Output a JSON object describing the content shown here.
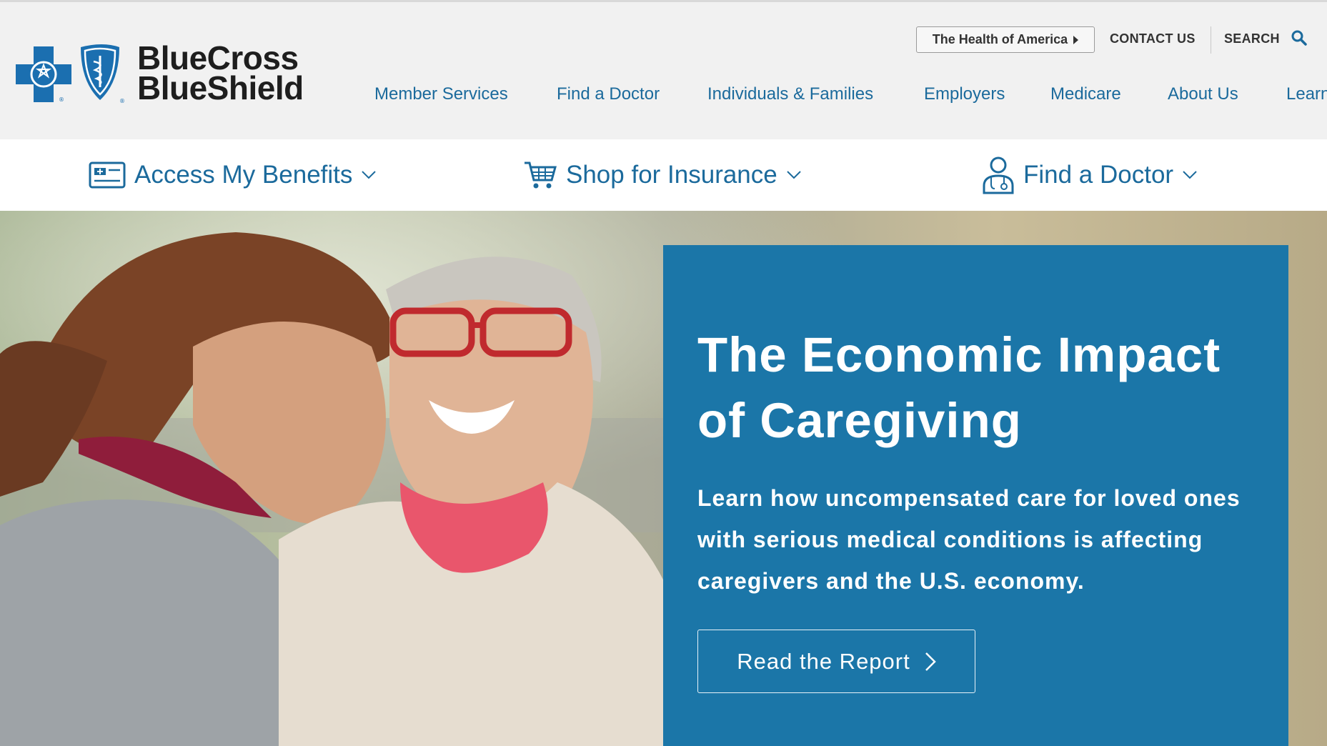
{
  "brand": {
    "line1": "BlueCross",
    "line2": "BlueShield",
    "cross_color": "#1b6fb0",
    "shield_color": "#1b6fb0"
  },
  "utility_nav": {
    "health_of_america": "The Health of America",
    "contact": "CONTACT US",
    "search": "SEARCH"
  },
  "main_nav": [
    {
      "label": "Member Services"
    },
    {
      "label": "Find a Doctor"
    },
    {
      "label": "Individuals & Families"
    },
    {
      "label": "Employers"
    },
    {
      "label": "Medicare"
    },
    {
      "label": "About Us"
    },
    {
      "label": "Learn"
    }
  ],
  "sub_nav": [
    {
      "label": "Access My Benefits",
      "icon": "id-card-icon"
    },
    {
      "label": "Shop for Insurance",
      "icon": "shopping-cart-icon"
    },
    {
      "label": "Find a Doctor",
      "icon": "doctor-icon"
    }
  ],
  "hero": {
    "title": "The Economic Impact of Caregiving",
    "body": "Learn how uncompensated care for loved ones with serious medical conditions is affecting caregivers and the U.S. economy.",
    "cta": "Read the Report",
    "panel_color": "#1b76a8"
  },
  "colors": {
    "link": "#1b6a9c",
    "header_bg": "#f1f1f1"
  }
}
